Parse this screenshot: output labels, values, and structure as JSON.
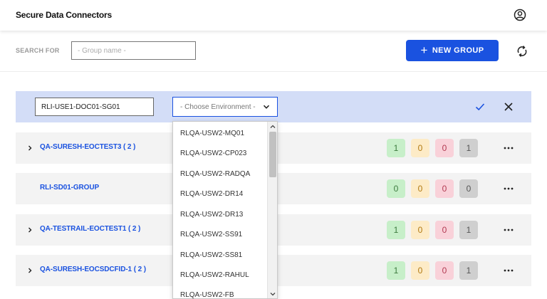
{
  "header": {
    "title": "Secure Data Connectors",
    "user_icon": "user-circle-icon"
  },
  "toolbar": {
    "search_label": "SEARCH FOR",
    "search_placeholder": "- Group name -",
    "search_value": "",
    "new_group_label": "NEW GROUP",
    "new_group_icon": "plus-icon",
    "refresh_icon": "refresh-icon"
  },
  "edit_row": {
    "name_value": "RLI-USE1-DOC01-SG01",
    "env_placeholder": "- Choose Environment -",
    "confirm_icon": "checkmark-icon",
    "cancel_icon": "close-icon"
  },
  "dropdown": {
    "options": [
      "RLQA-USW2-MQ01",
      "RLQA-USW2-CP023",
      "RLQA-USW2-RADQA",
      "RLQA-USW2-DR14",
      "RLQA-USW2-DR13",
      "RLQA-USW2-SS91",
      "RLQA-USW2-SS81",
      "RLQA-USW2-RAHUL",
      "RLQA-USW2-FB"
    ]
  },
  "groups": [
    {
      "name": "QA-SURESH-EOCTEST3 ( 2 )",
      "expandable": true,
      "counts": [
        "1",
        "0",
        "0",
        "1"
      ]
    },
    {
      "name": "RLI-SD01-GROUP",
      "expandable": false,
      "counts": [
        "0",
        "0",
        "0",
        "0"
      ]
    },
    {
      "name": "QA-TESTRAIL-EOCTEST1 ( 2 )",
      "expandable": true,
      "counts": [
        "1",
        "0",
        "0",
        "1"
      ]
    },
    {
      "name": "QA-SURESH-EOCSDCFID-1 ( 2 )",
      "expandable": true,
      "counts": [
        "1",
        "0",
        "0",
        "1"
      ]
    }
  ],
  "colors": {
    "accent": "#1a52e0",
    "edit_row_bg": "#d3ddf7",
    "badge_green": "#c7efc9",
    "badge_orange": "#fdebc7",
    "badge_red": "#f9d1d9",
    "badge_gray": "#cfcfcf"
  }
}
